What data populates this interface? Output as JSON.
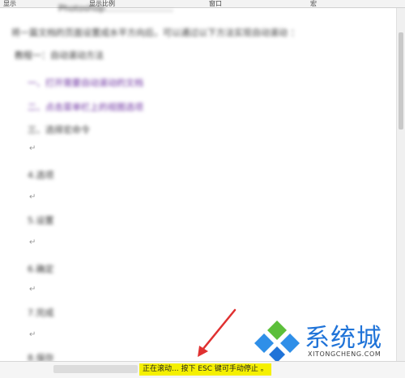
{
  "ribbon": {
    "groups": [
      "显示",
      "显示比例",
      "窗口",
      "宏"
    ]
  },
  "document": {
    "blurred_lines": [
      "将一篇文档的页面设置成水平方向后，可以通过以下方法实现自动滚动 ：",
      "教程一：自动滚动方法",
      "一、打开需要自动滚动的文档",
      "二、点击菜单栏上的视图选项",
      "三、选择宏命令",
      "4.选项",
      "5.设置",
      "6.确定",
      "7.完成",
      "8.保存"
    ],
    "paragraph_mark": "↵"
  },
  "status_bar": {
    "message": "正在滚动...  按下 ESC 键可手动停止 。"
  },
  "watermark": {
    "name": "系统城",
    "url": "XITONGCHENG.COM"
  },
  "colors": {
    "status_highlight": "#f5f000",
    "logo_blue": "#1f73d8",
    "logo_green": "#5cbf3a",
    "arrow_red": "#e03131"
  }
}
